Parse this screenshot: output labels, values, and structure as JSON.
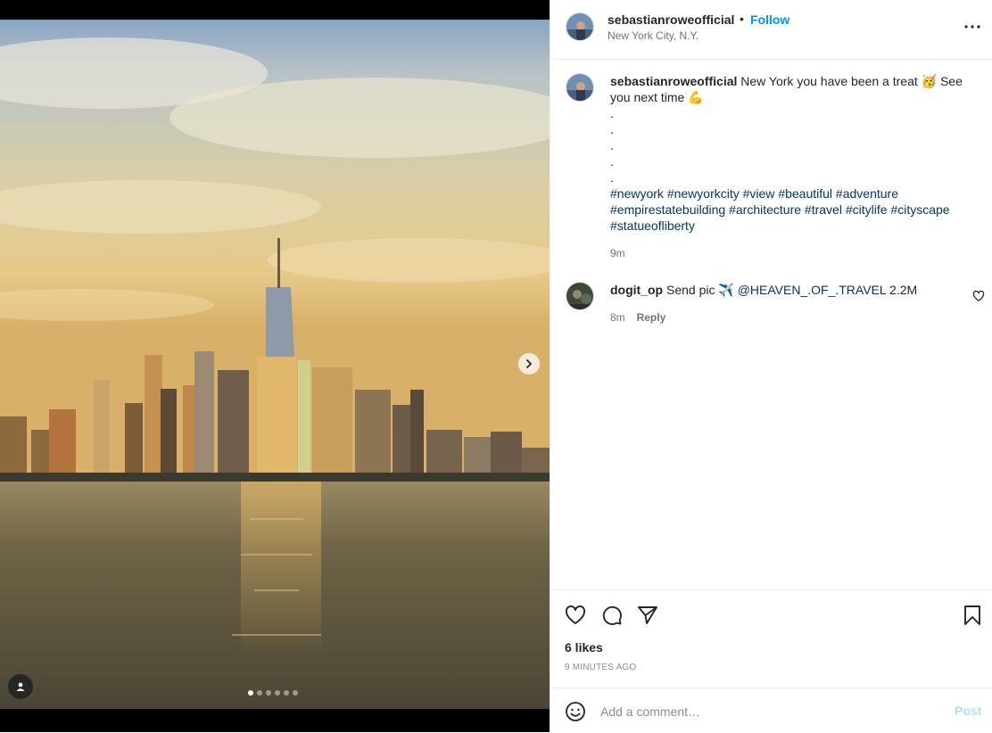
{
  "header": {
    "username": "sebastianroweofficial",
    "separator": "•",
    "follow_label": "Follow",
    "location": "New York City, N.Y.",
    "more_icon": "more-horizontal-icon"
  },
  "media": {
    "alt": "Lower Manhattan skyline at sunset across the Hudson River",
    "carousel_count": 6,
    "carousel_active_index": 0,
    "next_icon": "chevron-right-icon",
    "user_tag_icon": "user-icon"
  },
  "caption": {
    "username": "sebastianroweofficial",
    "text": "New York you have been a treat 🥳 See you next time 💪",
    "dots": [
      ".",
      ".",
      ".",
      ".",
      "."
    ],
    "hashtags": [
      "#newyork",
      "#newyorkcity",
      "#view",
      "#beautiful",
      "#adventure",
      "#empirestatebuilding",
      "#architecture",
      "#travel",
      "#citylife",
      "#cityscape",
      "#statueofliberty"
    ],
    "time": "9m"
  },
  "comments": [
    {
      "username": "dogit_op",
      "text_before": "Send pic ✈️ ",
      "mention": "@HEAVEN_.OF_.TRAVEL",
      "text_after": " 2.2M",
      "time": "8m",
      "reply_label": "Reply"
    }
  ],
  "actions": {
    "likes": "6 likes",
    "timestamp": "9 MINUTES AGO"
  },
  "add_comment": {
    "placeholder": "Add a comment…",
    "post_label": "Post"
  },
  "colors": {
    "accent": "#0095f6",
    "link": "#00376b",
    "post_disabled": "#b2dffc",
    "muted": "#737373"
  }
}
